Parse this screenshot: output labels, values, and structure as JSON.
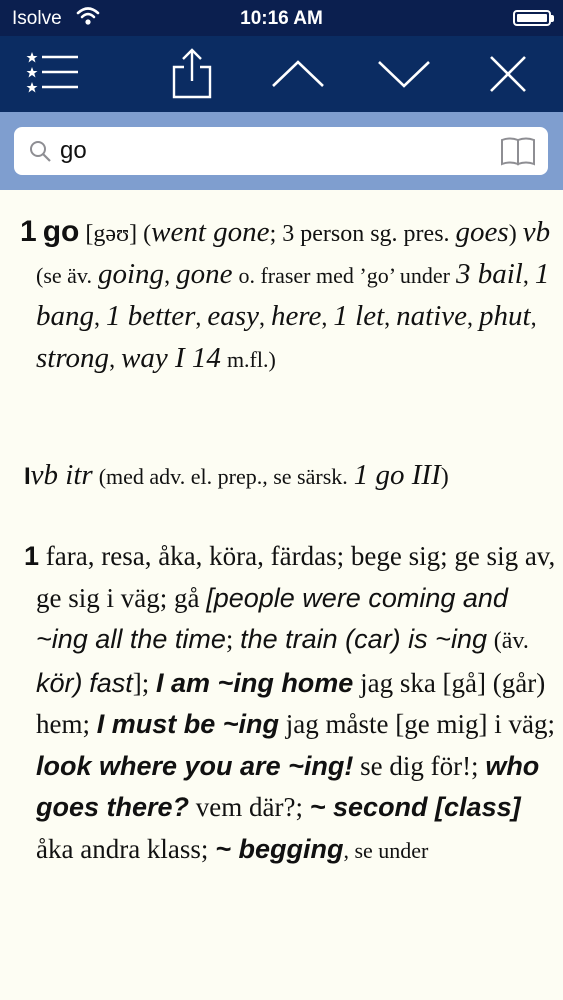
{
  "status_bar": {
    "carrier": "Isolve",
    "time": "10:16 AM",
    "battery_level": 1.0
  },
  "toolbar": {
    "buttons": [
      "list-icon",
      "share-icon",
      "chevron-up-icon",
      "chevron-down-icon",
      "close-icon"
    ]
  },
  "search": {
    "value": "go"
  },
  "entry": {
    "homograph": "1",
    "headword": "go",
    "pronunciation": "[gəʊ]",
    "forms_open": "(",
    "forms": "went gone",
    "forms_sep": ";",
    "forms_note": "3 person sg. pres.",
    "third_person": "goes",
    "forms_close": ")",
    "pos": "vb",
    "see_also_open": "(se äv.",
    "see_going": "going",
    "comma1": ",",
    "see_gone": "gone",
    "phrases_note": "o. fraser med ’go’ under",
    "refs": [
      {
        "text": "3 bail",
        "sep": ","
      },
      {
        "text": "1 bang",
        "sep": ","
      },
      {
        "text": "1 better",
        "sep": ","
      },
      {
        "text": "easy",
        "sep": ","
      },
      {
        "text": "here",
        "sep": ","
      },
      {
        "text": "1 let",
        "sep": ","
      },
      {
        "text": "native",
        "sep": ","
      },
      {
        "text": "phut",
        "sep": ","
      },
      {
        "text": "strong",
        "sep": ","
      },
      {
        "text": "way I 14",
        "sep": ""
      }
    ],
    "refs_end": "m.fl.)",
    "sense": {
      "roman": "I",
      "grammar": "vb itr",
      "note": "(med adv. el. prep., se särsk.",
      "link": "1 go III",
      "close": ")"
    },
    "sub1": {
      "number": "1",
      "translations": "fara, resa, åka, köra, färdas; bege sig; ge sig av, ge sig i väg; gå",
      "ex1": "[people were coming and ~ing all the time",
      "ex1_sep": ";",
      "ex2": "the train (car) is ~ing",
      "ex2_note_open": "(äv.",
      "ex2_kor": "kör)",
      "ex2_fast": "fast",
      "ex2_close": "];",
      "b1": "I am ~ing home",
      "t1": "jag ska [gå] (går) hem;",
      "b2": "I must be ~ing",
      "t2": "jag måste [ge mig] i väg;",
      "b3": "look where you are ~ing!",
      "t3": "se dig för!;",
      "b4": "who goes there?",
      "t4": "vem där?;",
      "b5": "~ second [class]",
      "t5": "åka andra klass;",
      "b6": "~ begging",
      "t6": ", se under"
    }
  }
}
